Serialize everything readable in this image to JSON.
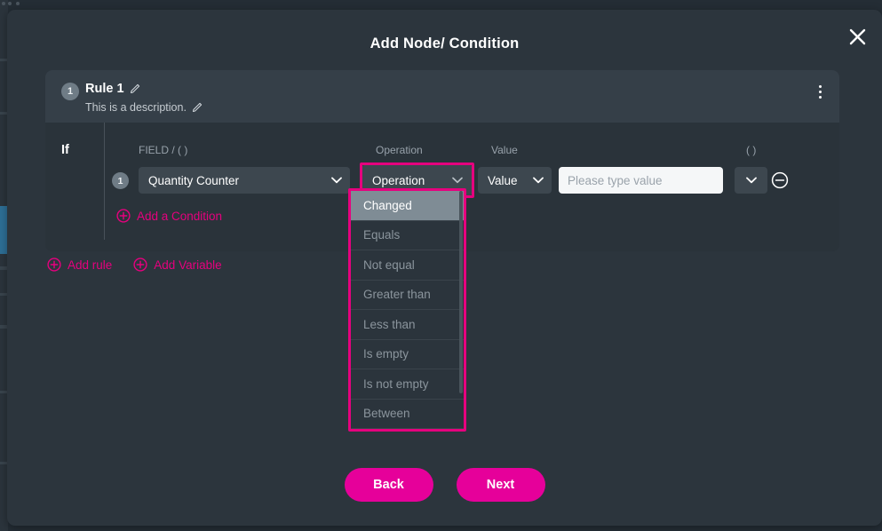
{
  "modal": {
    "title": "Add Node/ Condition",
    "close_icon": "close-icon"
  },
  "rule": {
    "badge": "1",
    "title": "Rule 1",
    "description": "This is a description.",
    "title_edit_icon": "pencil-icon",
    "desc_edit_icon": "pencil-icon",
    "menu_icon": "kebab-menu-icon"
  },
  "condition_table": {
    "if_label": "If",
    "headers": {
      "field": "FIELD / ( )",
      "operation": "Operation",
      "value": "Value",
      "paren": "( )"
    },
    "row": {
      "badge": "1",
      "field_value": "Quantity Counter",
      "operation_value": "Operation",
      "value_type": "Value",
      "value_placeholder": "Please type value",
      "paren_value": "",
      "remove_icon": "remove-circle-icon",
      "chevron_icon": "chevron-down-icon"
    },
    "add_condition_label": "Add a Condition"
  },
  "operation_dropdown": {
    "open": true,
    "selected": "Changed",
    "options": [
      "Changed",
      "Equals",
      "Not equal",
      "Greater than",
      "Less than",
      "Is empty",
      "Is not empty",
      "Between"
    ]
  },
  "footer_links": {
    "add_rule": "Add rule",
    "add_variable": "Add Variable"
  },
  "buttons": {
    "back": "Back",
    "next": "Next"
  },
  "colors": {
    "accent_magenta": "#e6007e",
    "button_magenta": "#e6009a",
    "modal_bg": "#2c353d",
    "card_bg": "#2a333a",
    "card_header_bg": "#353f48",
    "control_bg": "#3d474f",
    "highlight_bg": "#7f8c95",
    "input_bg": "#f5f7f8",
    "bg_accent_blue": "#2e6f96"
  }
}
